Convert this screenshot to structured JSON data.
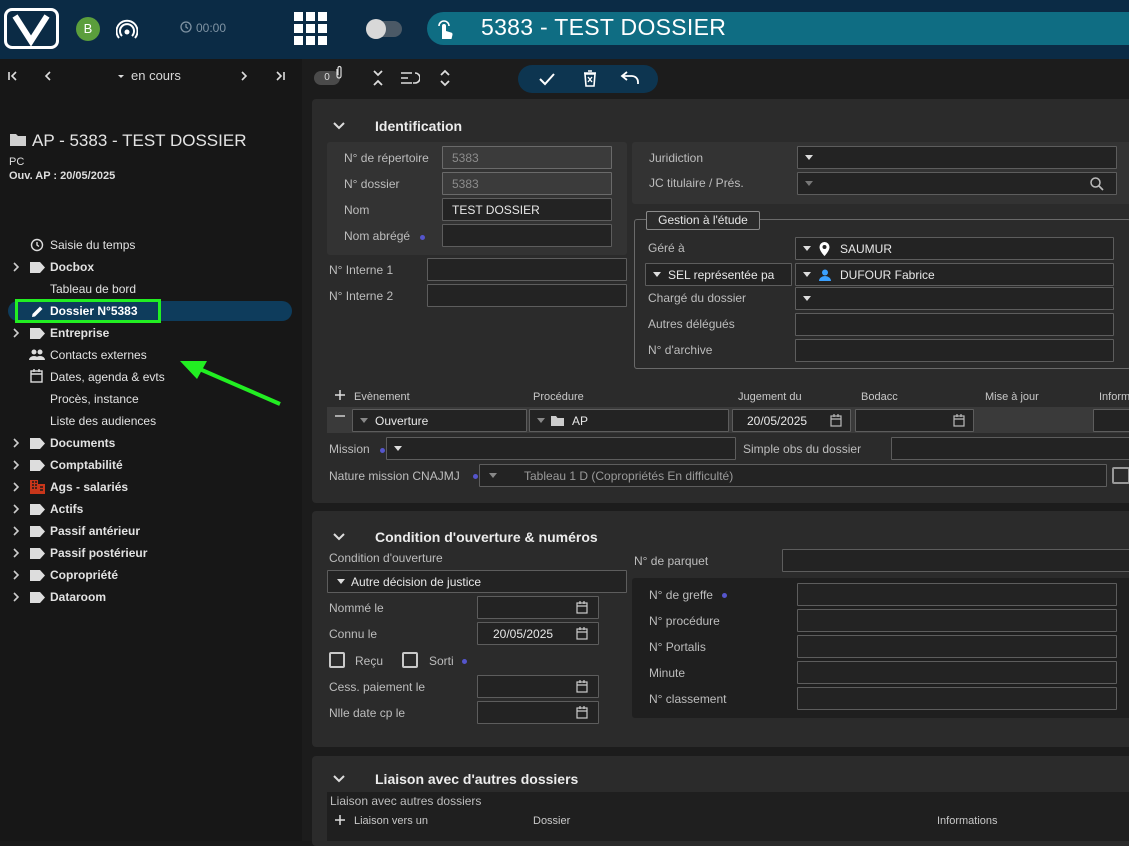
{
  "app": {
    "title": "5383 - TEST DOSSIER",
    "user_initial": "B",
    "timer": "00:00"
  },
  "nav": {
    "status": "en cours"
  },
  "toolbar": {
    "count": "0"
  },
  "dossier": {
    "title": "AP - 5383 - TEST DOSSIER",
    "type": "PC",
    "ouverture": "Ouv. AP : 20/05/2025"
  },
  "sidebar": {
    "items": [
      {
        "label": "Saisie du temps"
      },
      {
        "label": "Docbox"
      },
      {
        "label": "Tableau de bord"
      },
      {
        "label": "Dossier N°5383"
      },
      {
        "label": "Entreprise"
      },
      {
        "label": "Contacts externes"
      },
      {
        "label": "Dates, agenda & evts"
      },
      {
        "label": "Procès, instance"
      },
      {
        "label": "Liste des audiences"
      },
      {
        "label": "Documents"
      },
      {
        "label": "Comptabilité"
      },
      {
        "label": "Ags - salariés"
      },
      {
        "label": "Actifs"
      },
      {
        "label": "Passif antérieur"
      },
      {
        "label": "Passif postérieur"
      },
      {
        "label": "Copropriété"
      },
      {
        "label": "Dataroom"
      }
    ]
  },
  "identification": {
    "title": "Identification",
    "num_rep_label": "N° de répertoire",
    "num_rep": "5383",
    "num_dossier_label": "N° dossier",
    "num_dossier": "5383",
    "nom_label": "Nom",
    "nom": "TEST DOSSIER",
    "nom_abrege_label": "Nom abrégé",
    "interne1_label": "N° Interne 1",
    "interne2_label": "N° Interne 2",
    "juridiction_label": "Juridiction",
    "jc_label": "JC titulaire / Prés.",
    "gestion_legend": "Gestion à l'étude",
    "gere_label": "Géré à",
    "gere": "SAUMUR",
    "sel": "SEL représentée pa",
    "sel_value": "DUFOUR Fabrice",
    "charge_label": "Chargé du dossier",
    "autres_label": "Autres délégués",
    "archive_label": "N° d'archive"
  },
  "evenement": {
    "headers": {
      "evenement": "Evènement",
      "procedure": "Procédure",
      "jugement": "Jugement du",
      "bodacc": "Bodacc",
      "maj": "Mise à jour",
      "info": "Inform"
    },
    "evenement": "Ouverture",
    "procedure": "AP",
    "jugement": "20/05/2025",
    "mission_label": "Mission",
    "simple_obs_label": "Simple obs du dossier",
    "nature_label": "Nature mission CNAJMJ",
    "nature": "Tableau 1 D (Copropriétés En difficulté)"
  },
  "condition": {
    "title": "Condition d'ouverture & numéros",
    "cond_label": "Condition d'ouverture",
    "cond": "Autre décision de justice",
    "nomme_label": "Nommé le",
    "connu_label": "Connu le",
    "connu": "20/05/2025",
    "recu_label": "Reçu",
    "sorti_label": "Sorti",
    "cess_label": "Cess. paiement le",
    "nlle_label": "Nlle date cp le",
    "parquet_label": "N° de parquet",
    "greffe_label": "N° de greffe",
    "procedure_label": "N° procédure",
    "portalis_label": "N° Portalis",
    "minute_label": "Minute",
    "classement_label": "N° classement"
  },
  "liaison": {
    "title": "Liaison avec d'autres dossiers",
    "subtitle": "Liaison avec autres dossiers",
    "col_liaison": "Liaison vers un",
    "col_dossier": "Dossier",
    "col_info": "Informations"
  },
  "colors": {
    "highlight": "#22ee22",
    "titlebar": "#0f6d83",
    "topbar": "#0b2b45"
  }
}
